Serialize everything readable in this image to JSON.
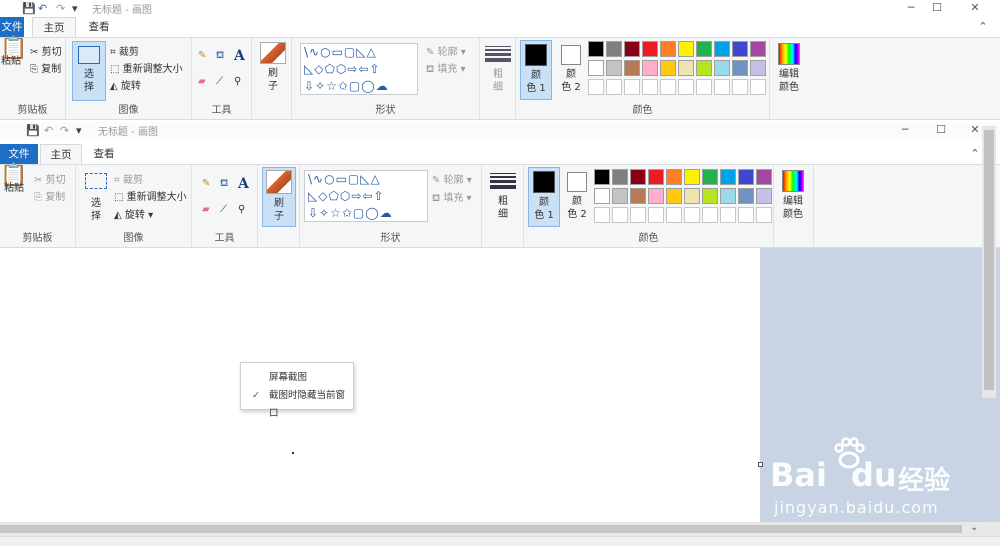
{
  "window_back": {
    "title": "无标题 - 画图",
    "tabs": {
      "file": "文件",
      "home": "主页",
      "view": "查看"
    },
    "groups": {
      "clipboard": "剪贴板",
      "image": "图像",
      "tools": "工具",
      "shapes": "形状",
      "colors": "颜色"
    },
    "clipboard": {
      "paste": "粘贴",
      "cut": "剪切",
      "copy": "复制"
    },
    "image": {
      "select": "选",
      "select2": "择",
      "crop": "裁剪",
      "resize": "重新调整大小",
      "rotate": "旋转"
    },
    "brush": {
      "l1": "刷",
      "l2": "子"
    },
    "outline": "轮廓",
    "fill": "填充",
    "size": {
      "l1": "粗",
      "l2": "细"
    },
    "color1": {
      "l1": "颜",
      "l2": "色 1"
    },
    "color2": {
      "l1": "颜",
      "l2": "色 2"
    },
    "edit_colors": {
      "l1": "编辑",
      "l2": "颜色"
    }
  },
  "window_front": {
    "title": "无标题 - 画图",
    "tabs": {
      "file": "文件",
      "home": "主页",
      "view": "查看"
    },
    "groups": {
      "clipboard": "剪贴板",
      "image": "图像",
      "tools": "工具",
      "shapes": "形状",
      "colors": "颜色"
    },
    "clipboard": {
      "paste": "粘贴",
      "cut": "剪切",
      "copy": "复制"
    },
    "image": {
      "select": "选",
      "select2": "择",
      "crop": "裁剪",
      "resize": "重新调整大小",
      "rotate": "旋转"
    },
    "brush": {
      "l1": "刷",
      "l2": "子"
    },
    "outline": "轮廓",
    "fill": "填充",
    "size": {
      "l1": "粗",
      "l2": "细"
    },
    "color1": {
      "l1": "颜",
      "l2": "色 1"
    },
    "color2": {
      "l1": "颜",
      "l2": "色 2"
    },
    "edit_colors": {
      "l1": "编辑",
      "l2": "颜色"
    }
  },
  "palette_row1": [
    "#000000",
    "#7f7f7f",
    "#880015",
    "#ed1c24",
    "#ff7f27",
    "#fff200",
    "#22b14c",
    "#00a2e8",
    "#3f48cc",
    "#a349a4"
  ],
  "palette_row2": [
    "#ffffff",
    "#c3c3c3",
    "#b97a57",
    "#ffaec9",
    "#ffc90e",
    "#efe4b0",
    "#b5e61d",
    "#99d9ea",
    "#7092be",
    "#c8bfe7"
  ],
  "context_menu": {
    "items": [
      {
        "label": "屏幕截图",
        "checked": false
      },
      {
        "label": "截图时隐藏当前窗口",
        "checked": true
      }
    ]
  },
  "watermark": {
    "brand": "Bai",
    "brand2": "du",
    "brand_cn": "经验",
    "url": "jingyan.baidu.com"
  },
  "icons": [
    "paste-icon",
    "scissors-icon",
    "copy-icon",
    "crop-icon",
    "resize-icon",
    "rotate-icon",
    "pencil-icon",
    "fill-icon",
    "text-icon",
    "eraser-icon",
    "color-picker-icon",
    "magnifier-icon",
    "brush-icon",
    "check-icon"
  ]
}
